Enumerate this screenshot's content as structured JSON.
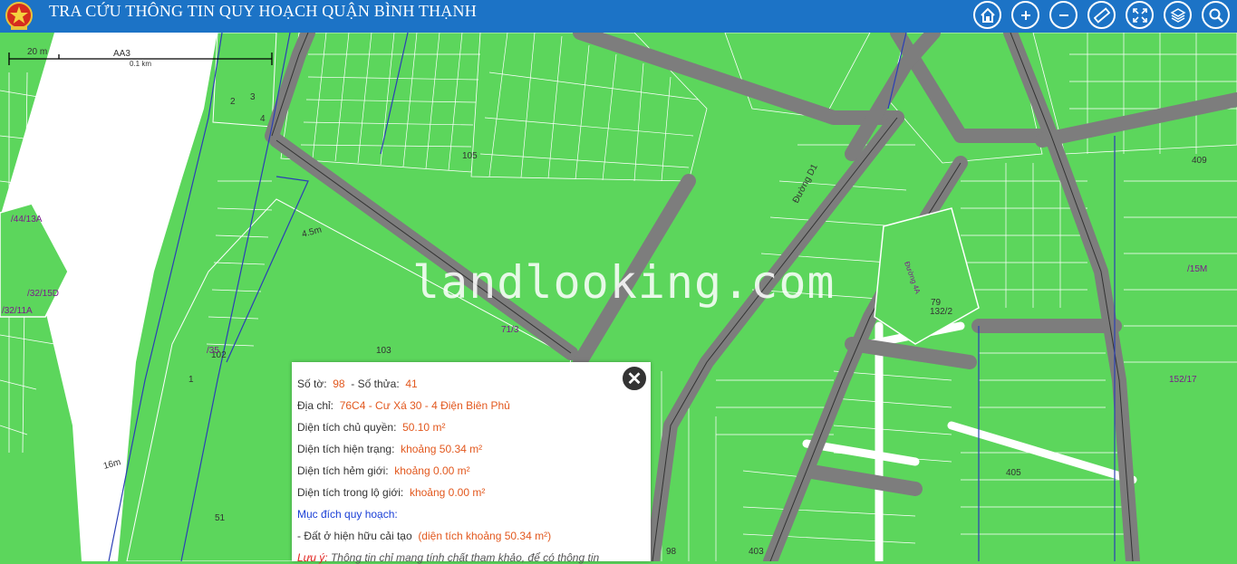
{
  "header": {
    "title": "TRA CỨU THÔNG TIN QUY HOẠCH QUẬN BÌNH THẠNH",
    "tools": [
      "home-icon",
      "zoom-in-icon",
      "zoom-out-icon",
      "measure-ruler-icon",
      "fullscreen-icon",
      "layers-icon",
      "search-icon"
    ]
  },
  "scale": {
    "label_short": "20 m",
    "label_long": "0.1 km"
  },
  "watermark": "landlooking.com",
  "map_labels": {
    "road_d1": "Đường D1",
    "road_4a": "Đường 4A",
    "parcel_103": "103",
    "parcel_51": "51",
    "parcel_16m": "16m",
    "parcel_1": "1",
    "parcel_2": "2",
    "parcel_3": "3",
    "parcel_4": "4",
    "parcel_79": "79",
    "parcel_132_2": "132/2",
    "parcel_409": "409",
    "parcel_152_17": "152/17",
    "parcel_15M": "/15M",
    "parcel_aa3": "AA3",
    "parcel_102": "102",
    "parcel_35": "/35",
    "parcel_71_3": "71/3",
    "parcel_4_5m": "4.5m",
    "parcel_403": "403",
    "parcel_98": "98",
    "parcel_105": "105",
    "parcel_405": "405",
    "parcel_44_13a": "/44/13A",
    "parcel_32_15d": "/32/15D",
    "parcel_32_11a": "/32/11A"
  },
  "popup": {
    "so_to_label": "Số tờ:",
    "so_to_value": "98",
    "so_thua_label": "- Số thửa:",
    "so_thua_value": "41",
    "dia_chi_label": "Địa chỉ:",
    "dia_chi_value": "76C4 - Cư Xá 30 - 4 Điện Biên Phủ",
    "dt_chu_quyen_label": "Diện tích chủ quyền:",
    "dt_chu_quyen_value": "50.10 m²",
    "dt_hien_trang_label": "Diện tích hiện trạng:",
    "dt_hien_trang_value": "khoảng 50.34 m²",
    "dt_hem_gioi_label": "Diện tích hẻm giới:",
    "dt_hem_gioi_value": "khoảng 0.00 m²",
    "dt_lo_gioi_label": "Diện tích trong lộ giới:",
    "dt_lo_gioi_value": "khoảng 0.00 m²",
    "muc_dich_label": "Mục đích quy hoạch:",
    "muc_dich_item": "- Đất ở hiện hữu cải tạo",
    "muc_dich_area": "(diện tích khoảng 50.34 m²)",
    "luu_y_label": "Lưu ý:",
    "luu_y_text": "Thông tin chỉ mang tính chất tham khảo, để có thông tin"
  },
  "colors": {
    "header": "#1c73c6",
    "parcel": "#5cd65c",
    "road": "#8a8a8a",
    "accent": "#e2581e"
  }
}
